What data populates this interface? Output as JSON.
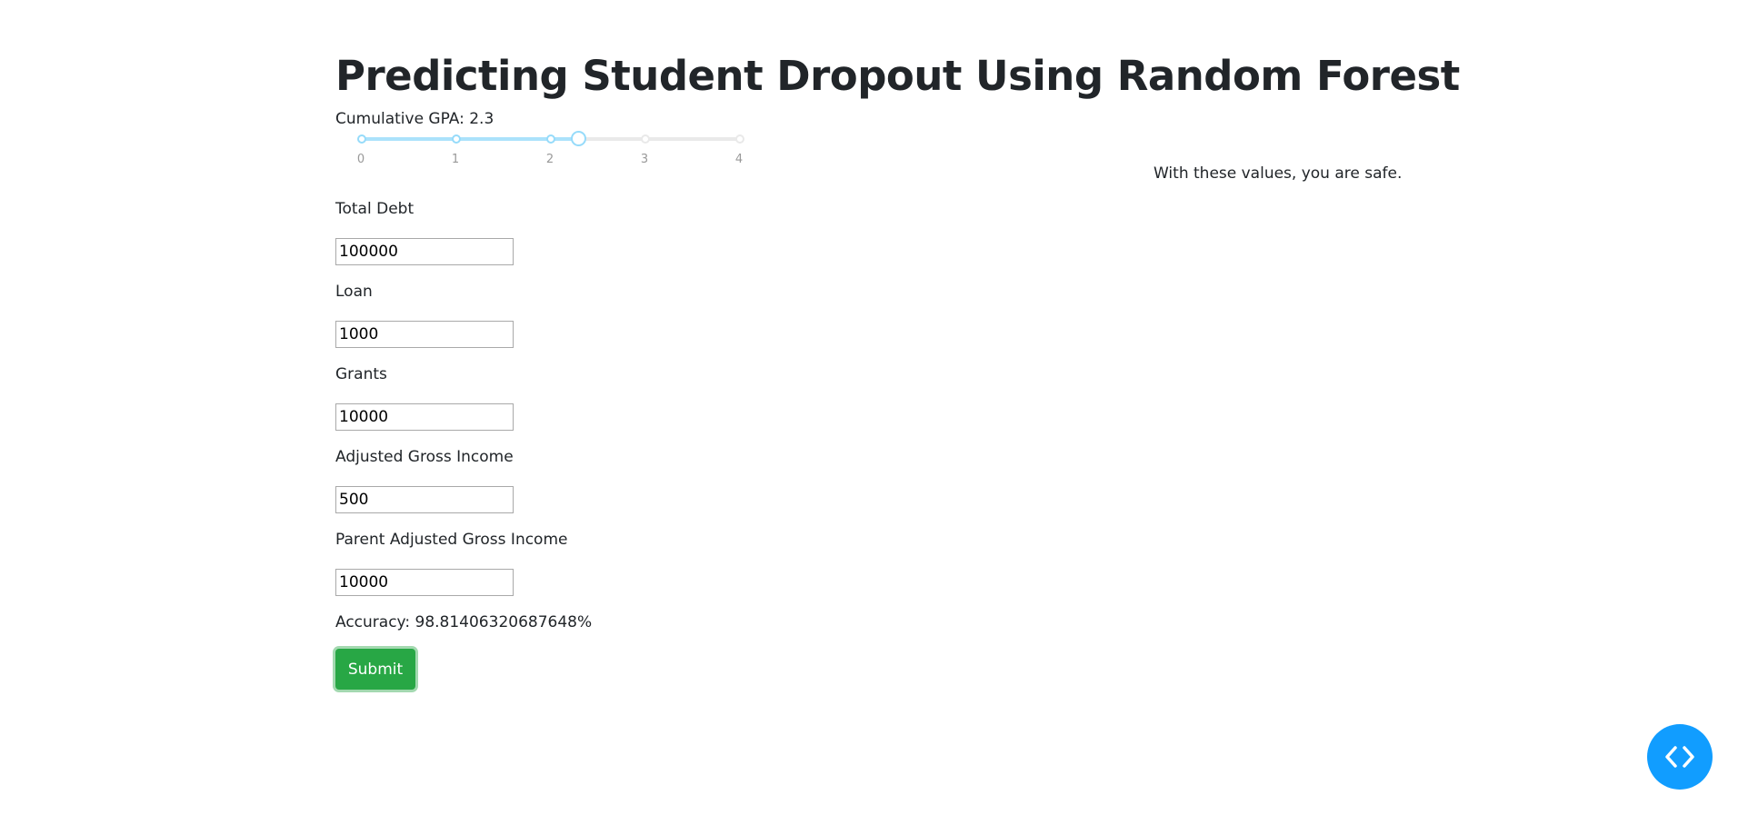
{
  "page": {
    "title": "Predicting Student Dropout Using Random Forest"
  },
  "gpa_slider": {
    "label": "Cumulative GPA: 2.3",
    "min": 0,
    "max": 4,
    "value": 2.3,
    "marks": [
      "0",
      "1",
      "2",
      "3",
      "4"
    ]
  },
  "fields": [
    {
      "label": "Total Debt",
      "value": "100000"
    },
    {
      "label": "Loan",
      "value": "1000"
    },
    {
      "label": "Grants",
      "value": "10000"
    },
    {
      "label": "Adjusted Gross Income",
      "value": "500"
    },
    {
      "label": "Parent Adjusted Gross Income",
      "value": "10000"
    }
  ],
  "accuracy": "Accuracy: 98.81406320687648%",
  "submit_label": "Submit",
  "result_text": "With these values, you are safe.",
  "colors": {
    "accent": "#96dbfa",
    "track": "#abe2fb",
    "submit": "#28a745",
    "fab": "#119dff"
  },
  "icons": {
    "fab": "code-icon"
  }
}
